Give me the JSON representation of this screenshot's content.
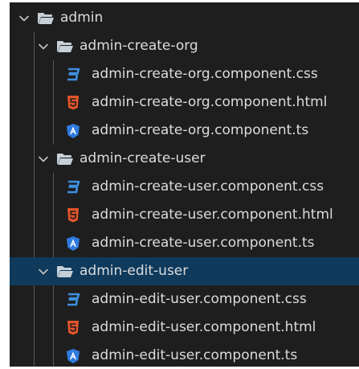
{
  "tree": {
    "items": [
      {
        "label": "admin",
        "type": "folder",
        "depth": 0,
        "expanded": true,
        "selected": false
      },
      {
        "label": "admin-create-org",
        "type": "folder",
        "depth": 1,
        "expanded": true,
        "selected": false
      },
      {
        "label": "admin-create-org.component.css",
        "type": "css",
        "depth": 2,
        "selected": false
      },
      {
        "label": "admin-create-org.component.html",
        "type": "html",
        "depth": 2,
        "selected": false
      },
      {
        "label": "admin-create-org.component.ts",
        "type": "ts",
        "depth": 2,
        "selected": false
      },
      {
        "label": "admin-create-user",
        "type": "folder",
        "depth": 1,
        "expanded": true,
        "selected": false
      },
      {
        "label": "admin-create-user.component.css",
        "type": "css",
        "depth": 2,
        "selected": false
      },
      {
        "label": "admin-create-user.component.html",
        "type": "html",
        "depth": 2,
        "selected": false
      },
      {
        "label": "admin-create-user.component.ts",
        "type": "ts",
        "depth": 2,
        "selected": false
      },
      {
        "label": "admin-edit-user",
        "type": "folder",
        "depth": 1,
        "expanded": true,
        "selected": true
      },
      {
        "label": "admin-edit-user.component.css",
        "type": "css",
        "depth": 2,
        "selected": false
      },
      {
        "label": "admin-edit-user.component.html",
        "type": "html",
        "depth": 2,
        "selected": false
      },
      {
        "label": "admin-edit-user.component.ts",
        "type": "ts",
        "depth": 2,
        "selected": false
      }
    ]
  },
  "icons": {
    "folder": "folder-open-icon",
    "css": "css-file-icon",
    "html": "html-file-icon",
    "ts": "angular-ts-file-icon",
    "chevron": "chevron-down-icon"
  },
  "colors": {
    "background": "#1e1e1e",
    "selected_row": "#0f3a5c",
    "text": "#dcdcdc",
    "folder": "#c5d0d8",
    "css_icon": "#3d8fe0",
    "html_icon": "#e4552b",
    "ts_icon": "#2f7be0",
    "chevron": "#c5c5c5"
  }
}
